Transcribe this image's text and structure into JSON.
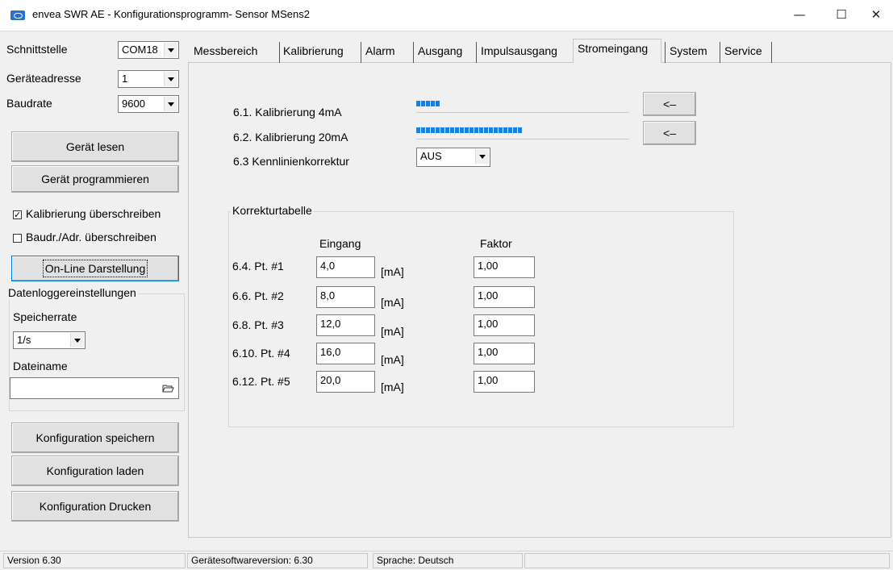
{
  "window": {
    "title": "envea SWR AE - Konfigurationsprogramm- Sensor MSens2",
    "minimize": "—",
    "maximize": "☐",
    "close": "✕"
  },
  "sidebar": {
    "schnittstelle_label": "Schnittstelle",
    "schnittstelle_value": "COM18",
    "geraeteadresse_label": "Geräteadresse",
    "geraeteadresse_value": "1",
    "baudrate_label": "Baudrate",
    "baudrate_value": "9600",
    "read_button": "Gerät lesen",
    "program_button": "Gerät programmieren",
    "chk_kalibrierung_label": "Kalibrierung überschreiben",
    "chk_kalibrierung_checked": true,
    "chk_baudr_label": "Baudr./Adr. überschreiben",
    "chk_baudr_checked": false,
    "online_button": "On-Line Darstellung",
    "datalogger": {
      "legend": "Datenloggereinstellungen",
      "speicherrate_label": "Speicherrate",
      "speicherrate_value": "1/s",
      "dateiname_label": "Dateiname",
      "dateiname_value": ""
    },
    "save_button": "Konfiguration speichern",
    "load_button": "Konfiguration laden",
    "print_button": "Konfiguration Drucken"
  },
  "tabs": [
    {
      "label": "Messbereich"
    },
    {
      "label": "Kalibrierung"
    },
    {
      "label": "Alarm"
    },
    {
      "label": "Ausgang"
    },
    {
      "label": "Impulsausgang"
    },
    {
      "label": "Stromeingang",
      "active": true
    },
    {
      "label": "System"
    },
    {
      "label": "Service"
    }
  ],
  "stromeingang": {
    "cal4_label": "6.1. Kalibrierung 4mA",
    "cal4_progress": 0.11,
    "cal20_label": "6.2. Kalibrierung 20mA",
    "cal20_progress": 0.5,
    "apply_button": "<–",
    "kennlinie_label": "6.3 Kennlinienkorrektur",
    "kennlinie_value": "AUS",
    "table": {
      "legend": "Korrekturtabelle",
      "col_eingang": "Eingang",
      "col_faktor": "Faktor",
      "unit": "[mA]",
      "rows": [
        {
          "label": "6.4. Pt. #1",
          "eingang": "4,0",
          "faktor": "1,00"
        },
        {
          "label": "6.6. Pt. #2",
          "eingang": "8,0",
          "faktor": "1,00"
        },
        {
          "label": "6.8. Pt. #3",
          "eingang": "12,0",
          "faktor": "1,00"
        },
        {
          "label": "6.10. Pt. #4",
          "eingang": "16,0",
          "faktor": "1,00"
        },
        {
          "label": "6.12. Pt. #5",
          "eingang": "20,0",
          "faktor": "1,00"
        }
      ]
    }
  },
  "statusbar": {
    "version": "Version 6.30",
    "software_version": "Gerätesoftwareversion: 6.30",
    "language": "Sprache: Deutsch"
  },
  "colors": {
    "progress": "#1e7fd6",
    "focus": "#0078d7"
  }
}
